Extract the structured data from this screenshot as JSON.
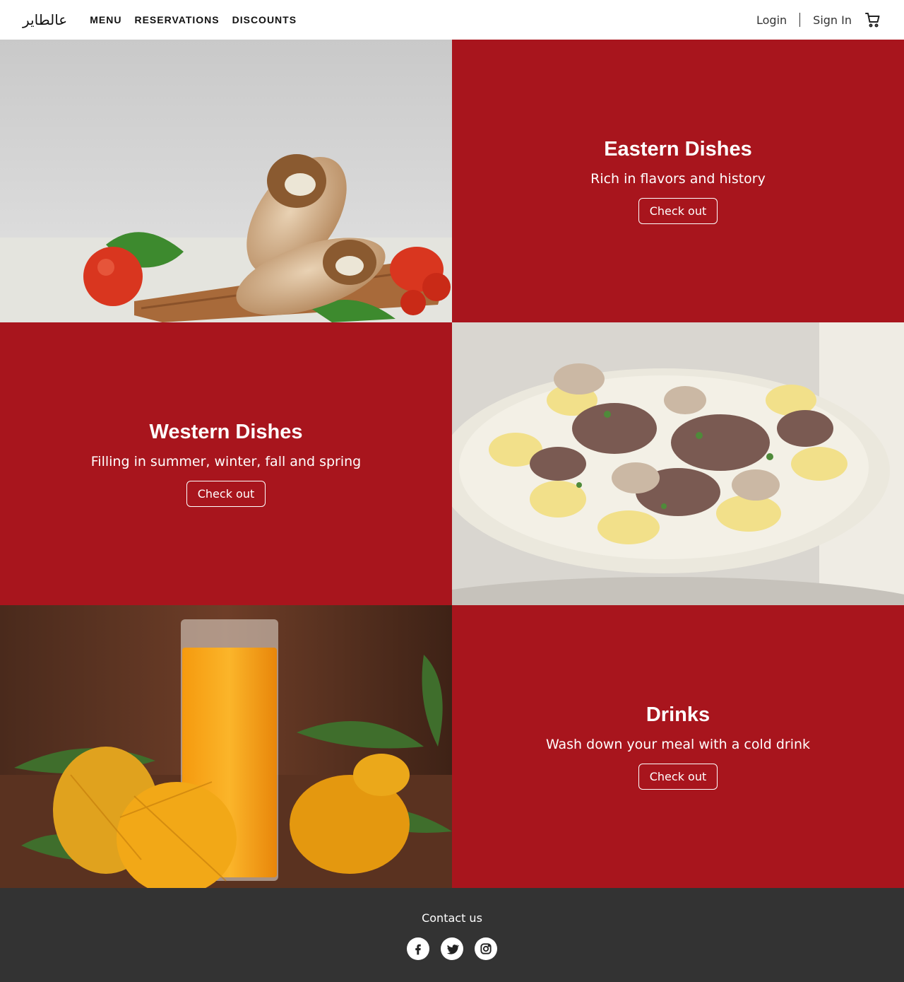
{
  "header": {
    "logo": "عالطاير",
    "nav": [
      "MENU",
      "RESERVATIONS",
      "DISCOUNTS"
    ],
    "login": "Login",
    "signin": "Sign In",
    "cart_icon": "cart-icon"
  },
  "sections": [
    {
      "title": "Eastern Dishes",
      "subtitle": "Rich in flavors and history",
      "button": "Check out",
      "image": "shawarma-wrap-photo"
    },
    {
      "title": "Western Dishes",
      "subtitle": "Filling in summer, winter, fall and spring",
      "button": "Check out",
      "image": "beef-stroganoff-photo"
    },
    {
      "title": "Drinks",
      "subtitle": "Wash down your meal with a cold drink",
      "button": "Check out",
      "image": "mango-juice-photo"
    }
  ],
  "footer": {
    "title": "Contact us",
    "socials": [
      "facebook-icon",
      "twitter-icon",
      "instagram-icon"
    ]
  },
  "colors": {
    "accent": "#a8151d",
    "footer_bg": "#333333"
  }
}
